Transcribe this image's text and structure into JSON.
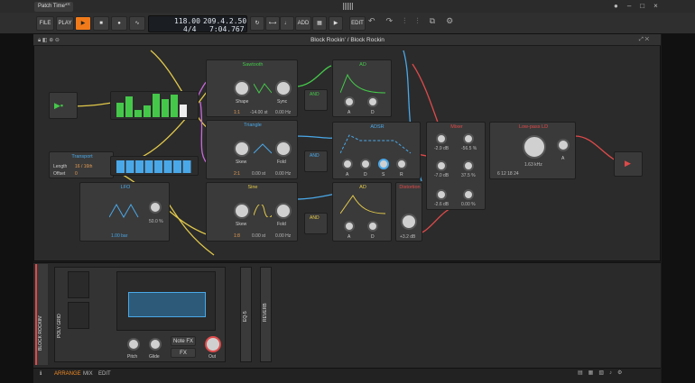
{
  "window": {
    "tab_title": "Patch Time*"
  },
  "toolbar": {
    "file": "FILE",
    "play": "PLAY",
    "add": "ADD",
    "edit": "EDIT",
    "tempo": "118.00",
    "signature": "4/4",
    "position": "209.4.2.50",
    "time": "7:04.767"
  },
  "editor": {
    "title": "Block Rockin' / Block Rockin"
  },
  "modules": {
    "sawtooth": {
      "title": "Sawtooth",
      "shape": "Shape",
      "sync": "Sync",
      "ratio": "1:1",
      "semitones": "-14.00 st",
      "hz": "0.00 Hz"
    },
    "triangle": {
      "title": "Triangle",
      "skew": "Skew",
      "fold": "Fold",
      "ratio": "2:1",
      "semitones": "0.00 st",
      "hz": "0.00 Hz"
    },
    "sine": {
      "title": "Sine",
      "skew": "Skew",
      "fold": "Fold",
      "ratio": "1:8",
      "semitones": "0.00 st",
      "hz": "0.00 Hz"
    },
    "ad1": {
      "title": "AD",
      "a": "A",
      "d": "D"
    },
    "adsr": {
      "title": "ADSR",
      "a": "A",
      "d": "D",
      "s": "S",
      "r": "R"
    },
    "ad2": {
      "title": "AD",
      "a": "A",
      "d": "D"
    },
    "distortion": {
      "title": "Distortion",
      "value": "+3.2 dB"
    },
    "mixer": {
      "title": "Mixer",
      "r1a": "-2.9 dB",
      "r1b": "-56.5 %",
      "r2a": "-7.0 dB",
      "r2b": "37.5 %",
      "r3a": "-2.6 dB",
      "r3b": "0.00 %"
    },
    "lowpass": {
      "title": "Low-pass LD",
      "freq": "1.63 kHz",
      "a": "A",
      "slopes": "6  12  18  24"
    },
    "transport": {
      "title": "Transport",
      "length_label": "Length",
      "length": "16 / 16th",
      "offset_label": "Offset",
      "offset": "0"
    },
    "lfo": {
      "title": "LFO",
      "amount": "50.0 %",
      "rate": "1.00 bar"
    },
    "and": "AND"
  },
  "bottom": {
    "track": "BLOCK ROCKIN'",
    "device": "POLY GRID",
    "pitch": "Pitch",
    "glide": "Glide",
    "out": "Out",
    "notefx": "Note FX",
    "fx": "FX",
    "eq": "EQ-5",
    "reverb": "REVERB"
  },
  "status": {
    "arrange": "ARRANGE",
    "mix": "MIX",
    "edit": "EDIT"
  },
  "colors": {
    "accent": "#f08a24",
    "active": "#f07a1a",
    "green": "#45c84a",
    "blue": "#4aa8e8"
  }
}
